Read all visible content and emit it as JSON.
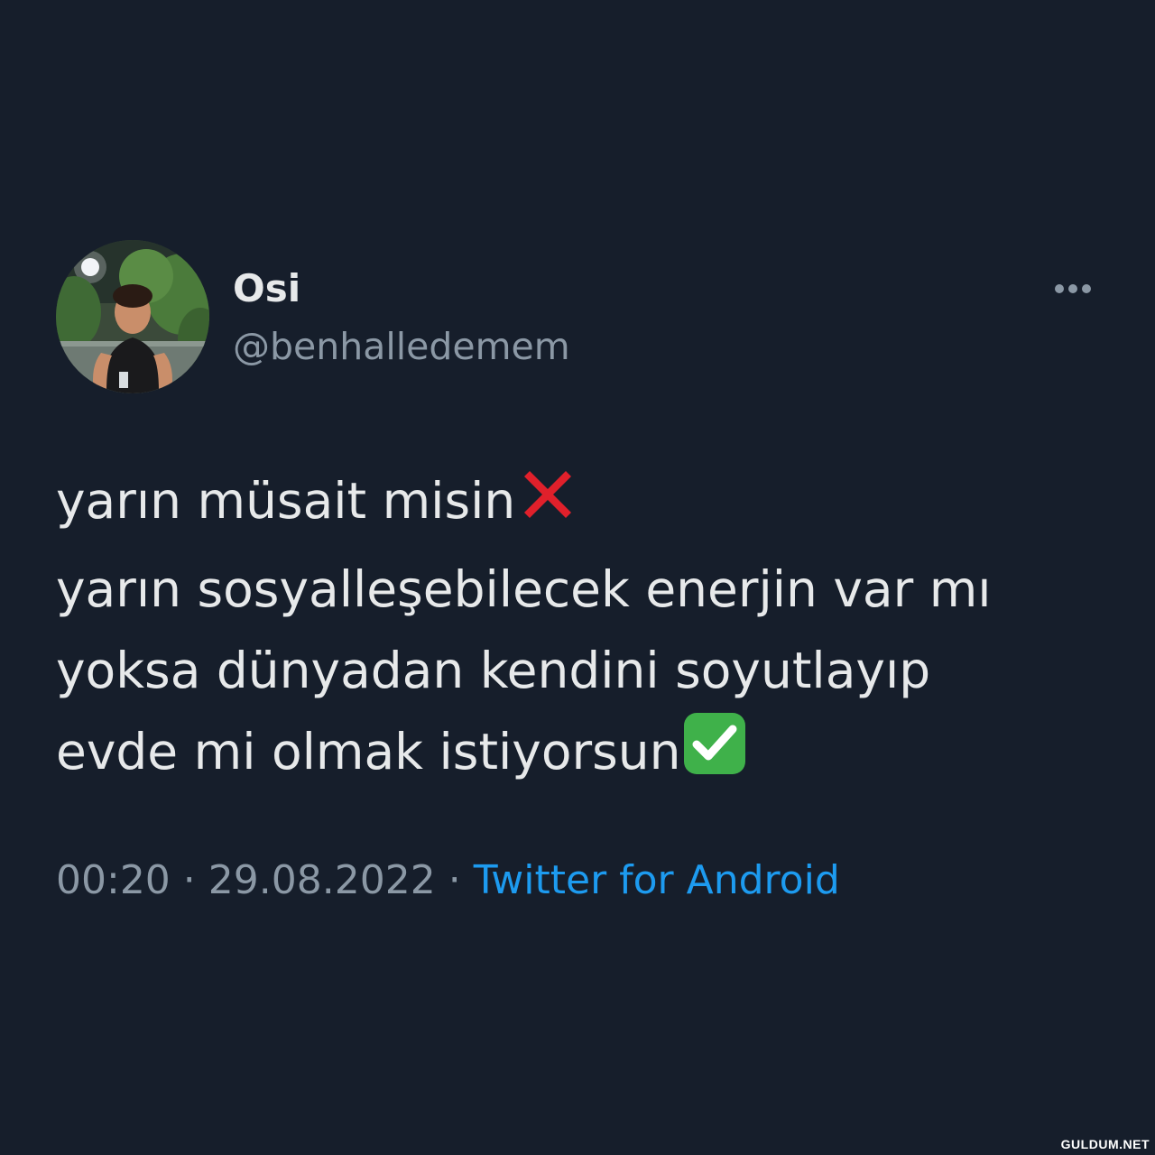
{
  "author": {
    "display_name": "Osi",
    "handle": "@benhalledemem"
  },
  "more_icon": "more-horizontal-icon",
  "tweet": {
    "lines": [
      "yarın müsait misin",
      "yarın sosyalleşebilecek enerjin var mı",
      "yoksa dünyadan kendini soyutlayıp",
      "evde mi olmak istiyorsun"
    ],
    "emoji_1": "cross-mark-emoji",
    "emoji_2": "check-mark-button-emoji"
  },
  "meta": {
    "time": "00:20",
    "separator_1": " · ",
    "date": "29.08.2022",
    "separator_2": " · ",
    "source": "Twitter for Android"
  },
  "watermark": "GULDUM.NET",
  "colors": {
    "background": "#161e2b",
    "primary_text": "#e7e9ea",
    "secondary_text": "#8b98a5",
    "link": "#1d9bf0"
  }
}
